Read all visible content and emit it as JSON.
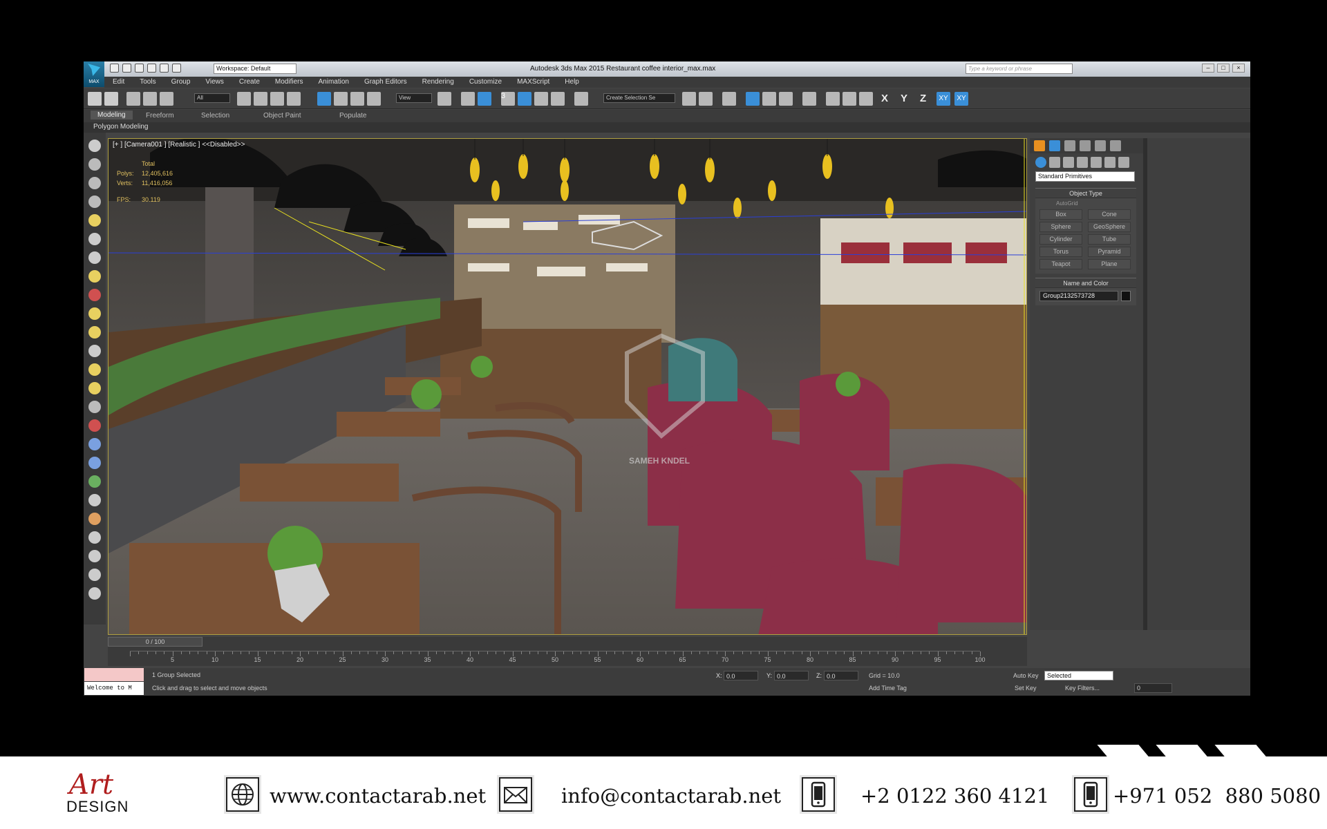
{
  "titlebar": {
    "workspace": "Workspace: Default",
    "title": "Autodesk 3ds Max  2015     Restaurant coffee interior_max.max",
    "search_placeholder": "Type a keyword or phrase",
    "app_label": "MAX"
  },
  "menu": [
    "Edit",
    "Tools",
    "Group",
    "Views",
    "Create",
    "Modifiers",
    "Animation",
    "Graph Editors",
    "Rendering",
    "Customize",
    "MAXScript",
    "Help"
  ],
  "toolbar": {
    "filter": "All",
    "view_dropdown": "View",
    "selection_set": "Create Selection Se",
    "snap_label": "3",
    "axis_x": "X",
    "axis_y": "Y",
    "axis_z": "Z",
    "axis_xy": "XY",
    "axis_xyz": "XY"
  },
  "ribbon": {
    "tabs": [
      "Modeling",
      "Freeform",
      "Selection",
      "Object Paint",
      "Populate"
    ],
    "active_tab": "Modeling",
    "subpanel": "Polygon Modeling"
  },
  "viewport": {
    "label": "[+ ] [Camera001 ] [Realistic ]  <<Disabled>>",
    "stats_header": "Total",
    "polys_label": "Polys:",
    "polys": "12,405,616",
    "verts_label": "Verts:",
    "verts": "11,416,056",
    "fps_label": "FPS:",
    "fps": "30.119",
    "watermark": "SAMEH KNDEL"
  },
  "command_panel": {
    "category": "Standard Primitives",
    "object_type_title": "Object Type",
    "autogrid": "AutoGrid",
    "primitives": [
      "Box",
      "Cone",
      "Sphere",
      "GeoSphere",
      "Cylinder",
      "Tube",
      "Torus",
      "Pyramid",
      "Teapot",
      "Plane"
    ],
    "name_color_title": "Name and Color",
    "object_name": "Group2132573728"
  },
  "timeline": {
    "slider": "0 / 100",
    "ticks": [
      "5",
      "10",
      "15",
      "20",
      "25",
      "30",
      "35",
      "40",
      "45",
      "50",
      "55",
      "60",
      "65",
      "70",
      "75",
      "80",
      "85",
      "90",
      "95",
      "100"
    ]
  },
  "status": {
    "maxscript_line": "Welcome to M",
    "selection_info": "1 Group Selected",
    "prompt": "Click and drag to select and move objects",
    "x_label": "X:",
    "x": "0.0",
    "y_label": "Y:",
    "y": "0.0",
    "z_label": "Z:",
    "z": "0.0",
    "grid": "Grid = 10.0",
    "add_time_tag": "Add Time Tag",
    "auto_key": "Auto Key",
    "set_key": "Set Key",
    "key_mode": "Selected",
    "key_filters": "Key Filters...",
    "frame": "0"
  },
  "footer": {
    "logo_art": "Art",
    "logo_design": "DESIGN",
    "website": "www.contactarab.net",
    "email": "info@contactarab.net",
    "phone1": "+2 0122 360 4121",
    "phone2": "+971 052  880 5080"
  },
  "colors": {
    "accent": "#3a8fd8",
    "viewport_border": "#b0a040",
    "logo_red": "#b01e1e"
  }
}
